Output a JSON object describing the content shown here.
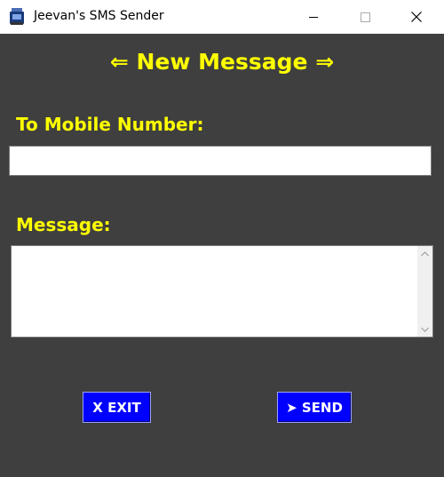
{
  "window": {
    "title": "Jeevan's SMS Sender",
    "buttons": [
      "minimize",
      "maximize",
      "close"
    ]
  },
  "form": {
    "heading": "⇐ New Message ⇒",
    "to_label": "To Mobile Number:",
    "to_value": "",
    "message_label": "Message:",
    "message_value": ""
  },
  "actions": {
    "exit_label": "X EXIT",
    "send_label": "➤ SEND"
  },
  "colors": {
    "background": "#3f3f3f",
    "label": "#ffff00",
    "button": "#0000ff",
    "button_text": "#ffffff"
  },
  "icons": {
    "app": "sms-app-icon",
    "close": "close-icon",
    "minimize": "minimize-icon",
    "maximize": "maximize-icon"
  }
}
